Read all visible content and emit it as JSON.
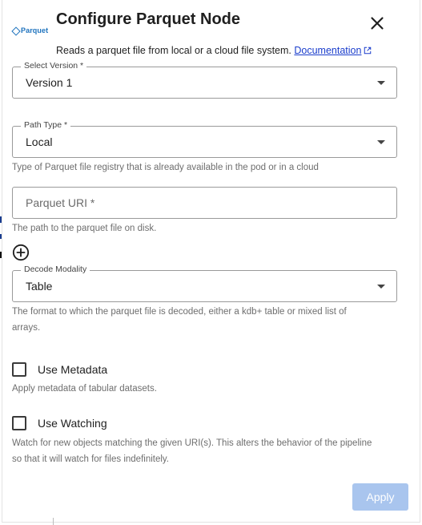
{
  "header": {
    "logo_text": "Parquet",
    "title": "Configure Parquet Node",
    "description": "Reads a parquet file from local or a cloud file system.",
    "doc_link": "Documentation"
  },
  "form": {
    "version": {
      "label": "Select Version *",
      "value": "Version 1"
    },
    "path_type": {
      "label": "Path Type *",
      "value": "Local",
      "helper": "Type of Parquet file registry that is already available in the pod or in a cloud"
    },
    "parquet_uri": {
      "placeholder": "Parquet URI *",
      "value": "",
      "helper": "The path to the parquet file on disk."
    },
    "decode_modality": {
      "label": "Decode Modality",
      "value": "Table",
      "helper": "The format to which the parquet file is decoded, either a kdb+ table or mixed list of arrays."
    },
    "use_metadata": {
      "label": "Use Metadata",
      "checked": false,
      "helper": "Apply metadata of tabular datasets."
    },
    "use_watching": {
      "label": "Use Watching",
      "checked": false,
      "helper": "Watch for new objects matching the given URI(s). This alters the behavior of the pipeline so that it will watch for files indefinitely."
    }
  },
  "footer": {
    "apply_label": "Apply",
    "apply_enabled": false
  },
  "colors": {
    "brand": "#1e73be",
    "link": "#1a3dcc",
    "apply_disabled_bg": "#a9c5ee",
    "helper_text": "#6e6e6e"
  },
  "icons": {
    "close": "close-icon",
    "external": "external-link-icon",
    "add": "add-circle-icon",
    "dropdown": "chevron-down-icon"
  }
}
